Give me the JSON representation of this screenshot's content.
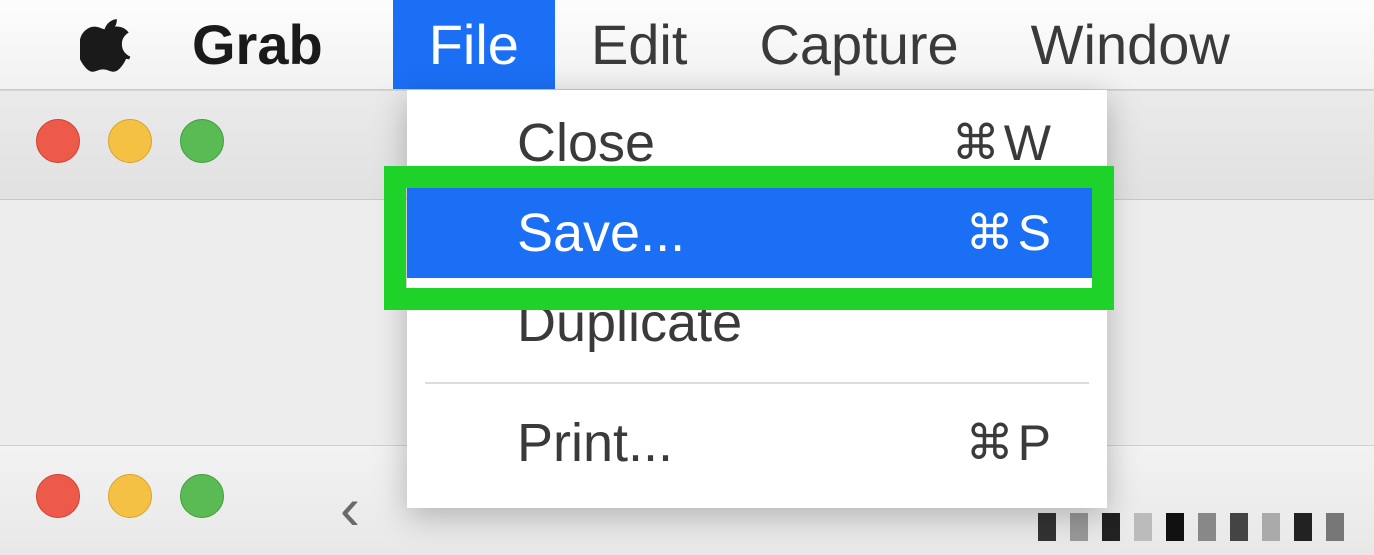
{
  "menubar": {
    "app_name": "Grab",
    "items": [
      {
        "label": "File",
        "active": true
      },
      {
        "label": "Edit",
        "active": false
      },
      {
        "label": "Capture",
        "active": false
      },
      {
        "label": "Window",
        "active": false
      }
    ]
  },
  "dropdown": {
    "items": [
      {
        "label": "Close",
        "shortcut_key": "W",
        "highlighted": false
      },
      {
        "label": "Save...",
        "shortcut_key": "S",
        "highlighted": true
      },
      {
        "label": "Duplicate",
        "shortcut_key": "",
        "highlighted": false
      },
      {
        "separator": true
      },
      {
        "label": "Print...",
        "shortcut_key": "P",
        "highlighted": false
      }
    ]
  },
  "shortcut_symbol": "⌘"
}
